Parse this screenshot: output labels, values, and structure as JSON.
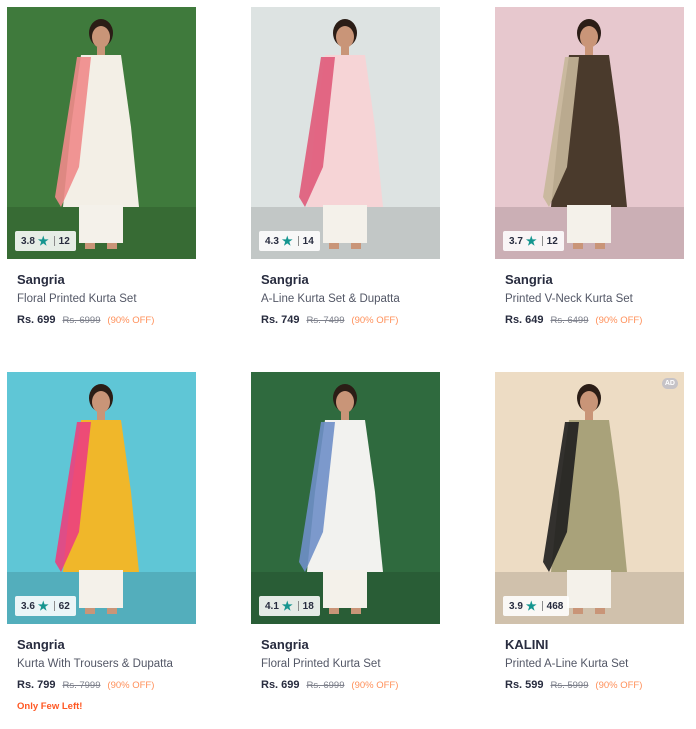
{
  "products": [
    {
      "brand": "Sangria",
      "title": "Floral Printed Kurta Set",
      "price": "Rs. 699",
      "mrp": "Rs. 6999",
      "discount": "(90% OFF)",
      "rating": "3.8",
      "reviews": "12",
      "ad": "",
      "stock": "",
      "bg": "#3f7a3c",
      "dress": "#f3efe6",
      "accent": "#f08a8a"
    },
    {
      "brand": "Sangria",
      "title": "A-Line Kurta Set & Dupatta",
      "price": "Rs. 749",
      "mrp": "Rs. 7499",
      "discount": "(90% OFF)",
      "rating": "4.3",
      "reviews": "14",
      "ad": "",
      "stock": "",
      "bg": "#dde3e2",
      "dress": "#f6d4d6",
      "accent": "#e05a7a"
    },
    {
      "brand": "Sangria",
      "title": "Printed V-Neck Kurta Set",
      "price": "Rs. 649",
      "mrp": "Rs. 6499",
      "discount": "(90% OFF)",
      "rating": "3.7",
      "reviews": "12",
      "ad": "",
      "stock": "",
      "bg": "#e7c8ce",
      "dress": "#4a3a2c",
      "accent": "#c7b79a"
    },
    {
      "brand": "Sangria",
      "title": "Kurta With Trousers & Dupatta",
      "price": "Rs. 799",
      "mrp": "Rs. 7999",
      "discount": "(90% OFF)",
      "rating": "3.6",
      "reviews": "62",
      "ad": "",
      "stock": "Only Few Left!",
      "bg": "#5fc6d6",
      "dress": "#f0b72a",
      "accent": "#ec3f7e"
    },
    {
      "brand": "Sangria",
      "title": "Floral Printed Kurta Set",
      "price": "Rs. 699",
      "mrp": "Rs. 6999",
      "discount": "(90% OFF)",
      "rating": "4.1",
      "reviews": "18",
      "ad": "",
      "stock": "",
      "bg": "#2f6a3e",
      "dress": "#f2f2ef",
      "accent": "#6f8fc8"
    },
    {
      "brand": "KALINI",
      "title": "Printed A-Line Kurta Set",
      "price": "Rs. 599",
      "mrp": "Rs. 5999",
      "discount": "(90% OFF)",
      "rating": "3.9",
      "reviews": "468",
      "ad": "AD",
      "stock": "",
      "bg": "#eddcc4",
      "dress": "#a9a27a",
      "accent": "#1e1e1e"
    }
  ]
}
